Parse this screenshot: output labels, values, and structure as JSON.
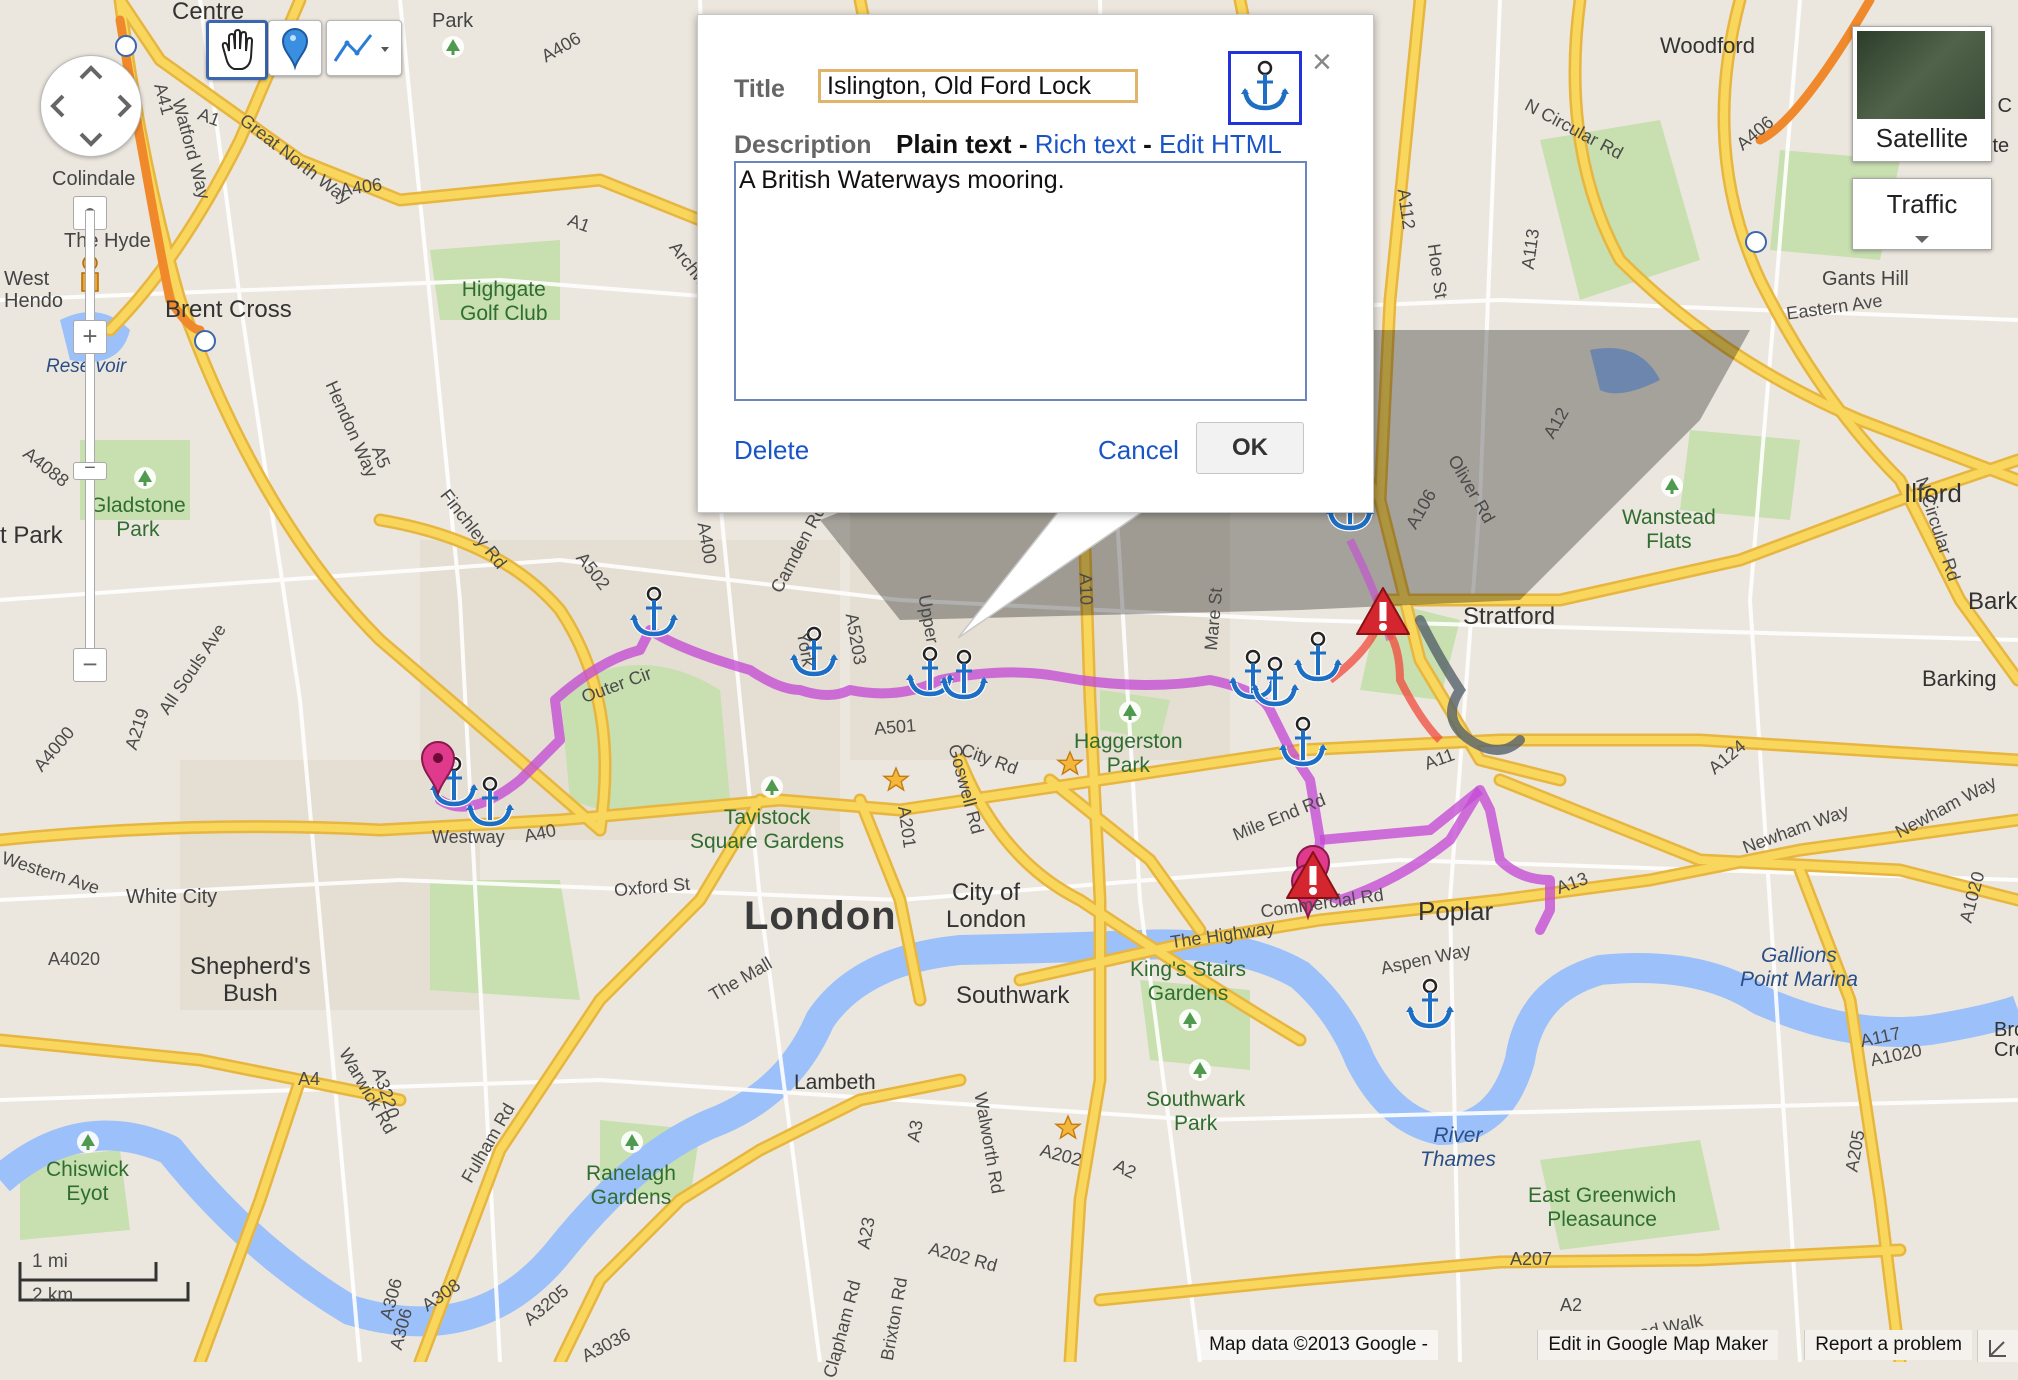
{
  "controls": {
    "satellite_label": "Satellite",
    "traffic_label": "Traffic"
  },
  "editor": {
    "title_label": "Title",
    "title_value": "Islington, Old Ford Lock",
    "description_label": "Description",
    "mode_plain": "Plain text",
    "sep": "-",
    "mode_rich": "Rich text",
    "mode_html": "Edit HTML",
    "description_value": "A British Waterways mooring.",
    "delete_label": "Delete",
    "cancel_label": "Cancel",
    "ok_label": "OK",
    "close_symbol": "×",
    "icon": "anchor-icon"
  },
  "map": {
    "city_label": "London",
    "places": {
      "woodford": "Woodford",
      "colindale": "Colindale",
      "the_hyde": "The Hyde",
      "west_hendon": "West\nHendo",
      "brent_cross": "Brent Cross",
      "reservoir": "Rese voir",
      "highgate_golf": "Highgate\nGolf Club",
      "gladstone_park": "Gladstone\nPark",
      "t_park": "t Park",
      "stratford": "Stratford",
      "wanstead_flats": "Wanstead\nFlats",
      "ilford": "Ilford",
      "barking": "Barking",
      "barkin": "Barkin",
      "gants_hill": "Gants Hill",
      "haggerston_park": "Haggerston\nPark",
      "tavistock": "Tavistock\nSquare Gardens",
      "city_of_london": "City of\nLondon",
      "poplar": "Poplar",
      "kings_stairs": "King's Stairs\nGardens",
      "southwark": "Southwark",
      "southwark_park": "Southwark\nPark",
      "lambeth": "Lambeth",
      "shepherds_bush": "Shepherd's\nBush",
      "white_city": "White City",
      "chiswick_eyot": "Chiswick\nEyot",
      "ranelagh": "Ranelagh\nGardens",
      "gallions": "Gallions\nPoint Marina",
      "river_thames": "River\nThames",
      "east_greenwich": "East Greenwich\nPleasaunce",
      "broad": "Broad\nCre",
      "westway": "Westway",
      "centre": "Centre",
      "park_top": "Park",
      "ilf": "lf C",
      "ite": "ite"
    },
    "roads": [
      "A406",
      "A1",
      "Great North Way",
      "A406",
      "Watford Way",
      "A41",
      "A5",
      "Hendon Way",
      "A4088",
      "Finchley Rd",
      "A502",
      "A400",
      "Camden Rd",
      "Archway",
      "N Circular Rd",
      "A5203",
      "Upper",
      "York",
      "A10",
      "Mare St",
      "A106",
      "Oliver Rd",
      "A12",
      "Hoe St",
      "A112",
      "A113",
      "Eastern Ave",
      "A124",
      "Newham Way",
      "A13",
      "A1020",
      "A11",
      "Mile End Rd",
      "Commercial Rd",
      "The Highway",
      "Aspen Way",
      "City Rd",
      "A501",
      "Goswell Rd",
      "A201",
      "Oxford St",
      "A40",
      "A219",
      "A4000",
      "All Souls Ave",
      "Outer Cir",
      "Western Ave",
      "A4020",
      "A4",
      "A3220",
      "Warwick Rd",
      "Fulham Rd",
      "A308",
      "A306",
      "A3205",
      "A3036",
      "A23",
      "A202",
      "A202 Rd",
      "Brixton Rd",
      "Clapham Rd",
      "Walworth Rd",
      "A3",
      "A2",
      "A207",
      "A205",
      "A117",
      "A1020",
      "A2",
      "The Mall",
      "A1",
      "Newham Way",
      "Road Walk",
      "A306",
      "N Circular Rd",
      "A406"
    ],
    "scale": {
      "mi": "1 mi",
      "km": "2 km"
    }
  },
  "footer": {
    "attribution": "Map data ©2013 Google -",
    "map_maker": "Edit in Google Map Maker",
    "report": "Report a problem"
  },
  "colors": {
    "route": "#c44bd6",
    "anchor": "#1e6fc4",
    "warning": "#d3262e",
    "river": "#9cc0f9",
    "major_road": "#f9d65c",
    "park": "#c8dfb0",
    "popup_border_accent": "#e0b46a"
  }
}
